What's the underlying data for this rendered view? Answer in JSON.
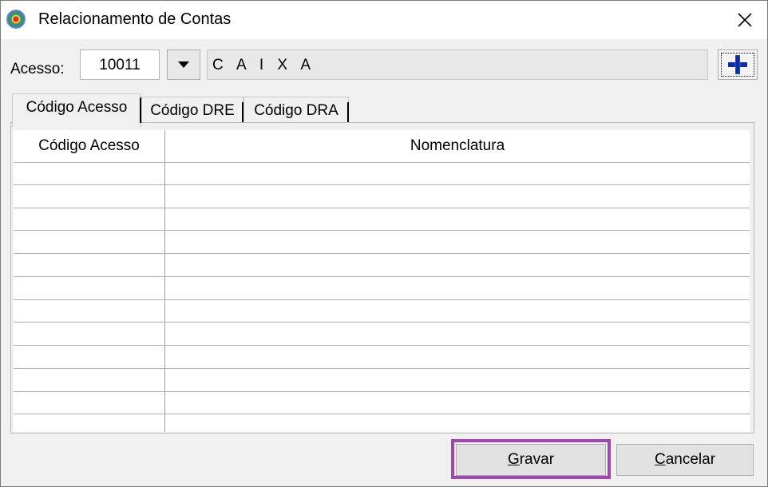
{
  "window": {
    "title": "Relacionamento de Contas",
    "icon": "app-globe-icon",
    "close_icon": "close-icon"
  },
  "acesso": {
    "label": "Acesso:",
    "value": "10011",
    "dropdown_icon": "chevron-down-icon",
    "account_name": "C A I X A",
    "add_icon": "plus-icon",
    "add_color": "#0a2fa8"
  },
  "tabs": [
    {
      "label": "Código Acesso",
      "active": true
    },
    {
      "label": "Código DRE",
      "active": false
    },
    {
      "label": "Código DRA",
      "active": false
    }
  ],
  "grid": {
    "columns": [
      "Código Acesso",
      "Nomenclatura"
    ],
    "rows": [
      [
        "",
        ""
      ],
      [
        "",
        ""
      ],
      [
        "",
        ""
      ],
      [
        "",
        ""
      ],
      [
        "",
        ""
      ],
      [
        "",
        ""
      ],
      [
        "",
        ""
      ],
      [
        "",
        ""
      ],
      [
        "",
        ""
      ],
      [
        "",
        ""
      ],
      [
        "",
        ""
      ],
      [
        "",
        ""
      ]
    ]
  },
  "buttons": {
    "save": {
      "label_first": "G",
      "label_rest": "ravar"
    },
    "cancel": {
      "label_first": "C",
      "label_rest": "ancelar"
    },
    "highlight_color": "#a148b0"
  }
}
